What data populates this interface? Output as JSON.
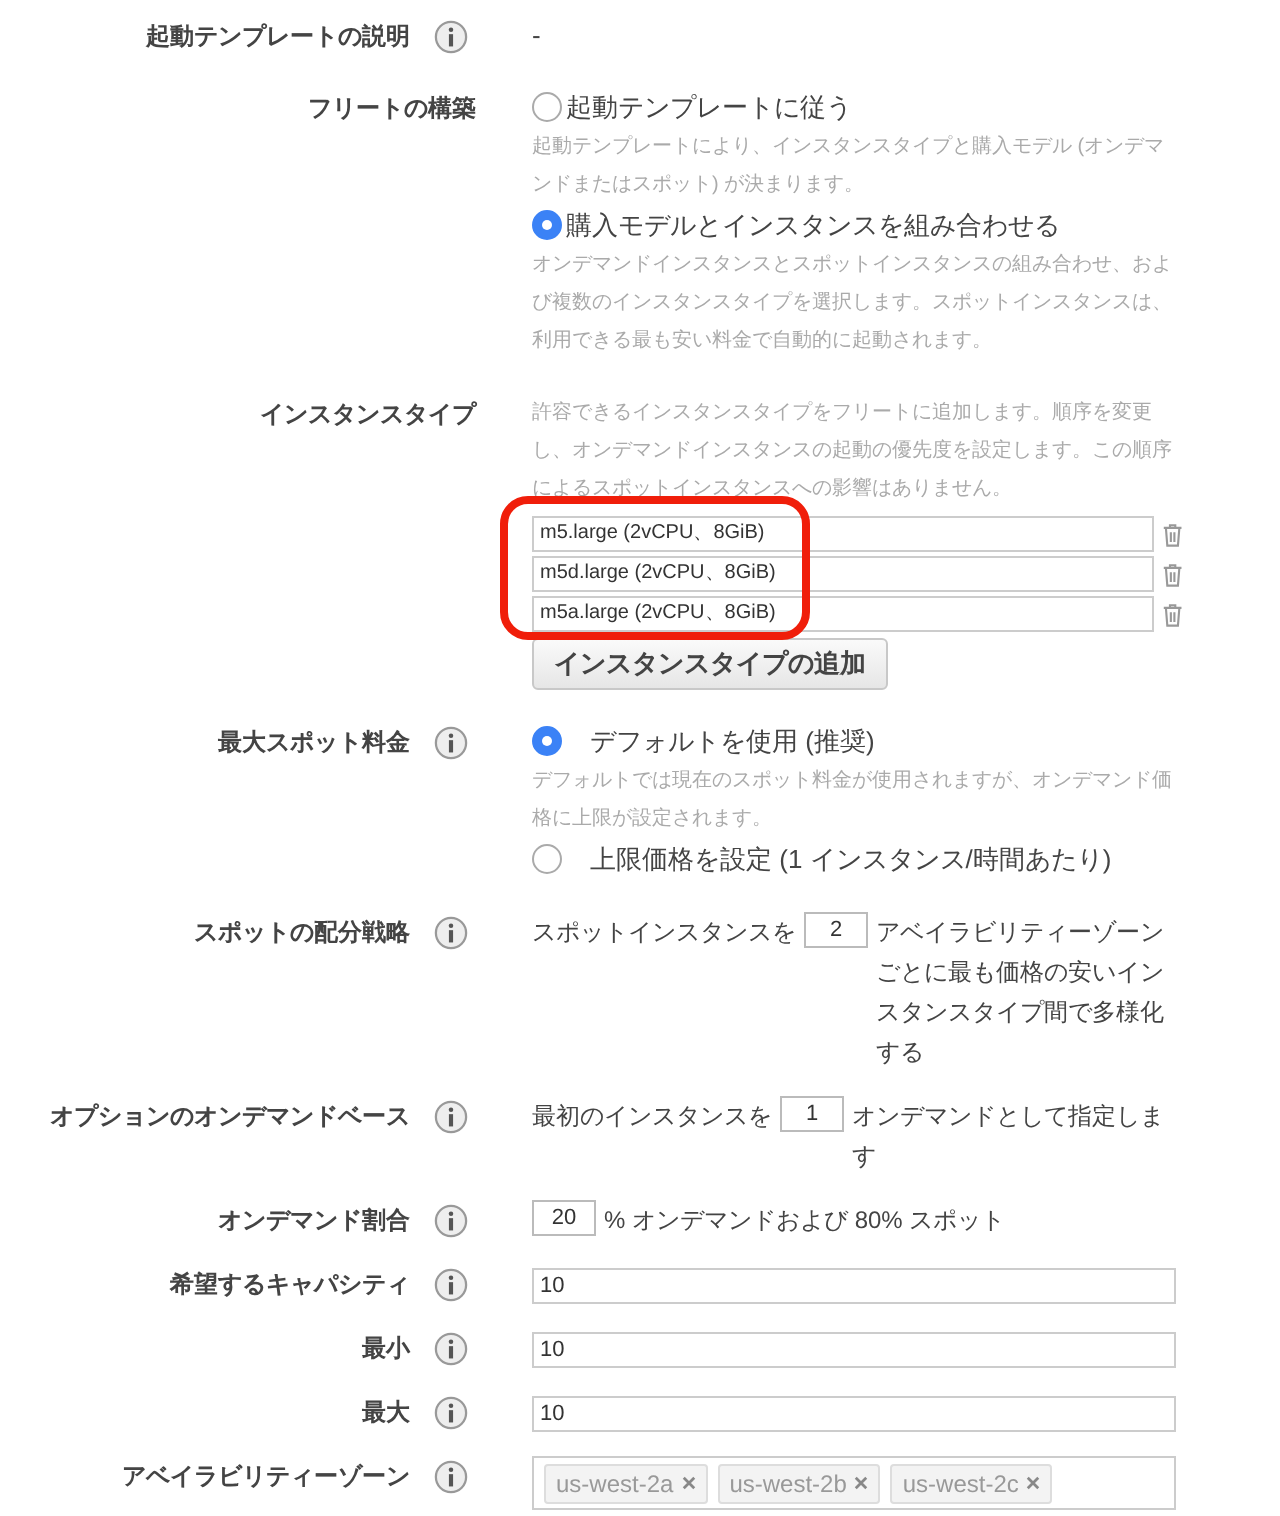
{
  "rows": [
    {
      "kind": "text",
      "label": "起動テンプレートの説明",
      "info": true,
      "value": "-"
    },
    {
      "kind": "radios",
      "label": "フリートの構築",
      "info": false,
      "options": [
        {
          "label": "起動テンプレートに従う",
          "description": "起動テンプレートにより、インスタンスタイプと購入モデル (オンデマンドまたはスポット) が決まります。",
          "selected": false
        },
        {
          "label": "購入モデルとインスタンスを組み合わせる",
          "description": "オンデマンドインスタンスとスポットインスタンスの組み合わせ、および複数のインスタンスタイプを選択します。スポットインスタンスは、利用できる最も安い料金で自動的に起動されます。",
          "selected": true
        }
      ]
    },
    {
      "kind": "instance_types",
      "label": "インスタンスタイプ",
      "info": false,
      "description": "許容できるインスタンスタイプをフリートに追加します。順序を変更し、オンデマンドインスタンスの起動の優先度を設定します。この順序によるスポットインスタンスへの影響はありません。",
      "types": [
        "m5.large (2vCPU、8GiB)",
        "m5d.large (2vCPU、8GiB)",
        "m5a.large (2vCPU、8GiB)"
      ],
      "add_button": "インスタンスタイプの追加"
    },
    {
      "kind": "radios",
      "label": "最大スポット料金",
      "info": true,
      "options": [
        {
          "label": "デフォルトを使用 (推奨)",
          "description": "デフォルトでは現在のスポット料金が使用されますが、オンデマンド価格に上限が設定されます。",
          "selected": true
        },
        {
          "label": "上限価格を設定 (1 インスタンス/時間あたり)",
          "selected": false
        }
      ]
    },
    {
      "kind": "inline",
      "label": "スポットの配分戦略",
      "info": true,
      "before": "スポットインスタンスを",
      "input": "2",
      "after": "アベイラビリティーゾーンごとに最も価格の安いインスタンスタイプ間で多様化する"
    },
    {
      "kind": "inline",
      "label": "オプションのオンデマンドベース",
      "info": true,
      "before": "最初のインスタンスを",
      "input": "1",
      "after": "オンデマンドとして指定します"
    },
    {
      "kind": "inline",
      "label": "オンデマンド割合",
      "info": true,
      "input": "20",
      "after": "% オンデマンドおよび 80% スポット"
    },
    {
      "kind": "field",
      "label": "希望するキャパシティ",
      "info": true,
      "value": "10"
    },
    {
      "kind": "field",
      "label": "最小",
      "info": true,
      "value": "10"
    },
    {
      "kind": "field",
      "label": "最大",
      "info": true,
      "value": "10"
    },
    {
      "kind": "tags",
      "label": "アベイラビリティーゾーン",
      "info": true,
      "tags": [
        "us-west-2a",
        "us-west-2b",
        "us-west-2c"
      ]
    }
  ]
}
